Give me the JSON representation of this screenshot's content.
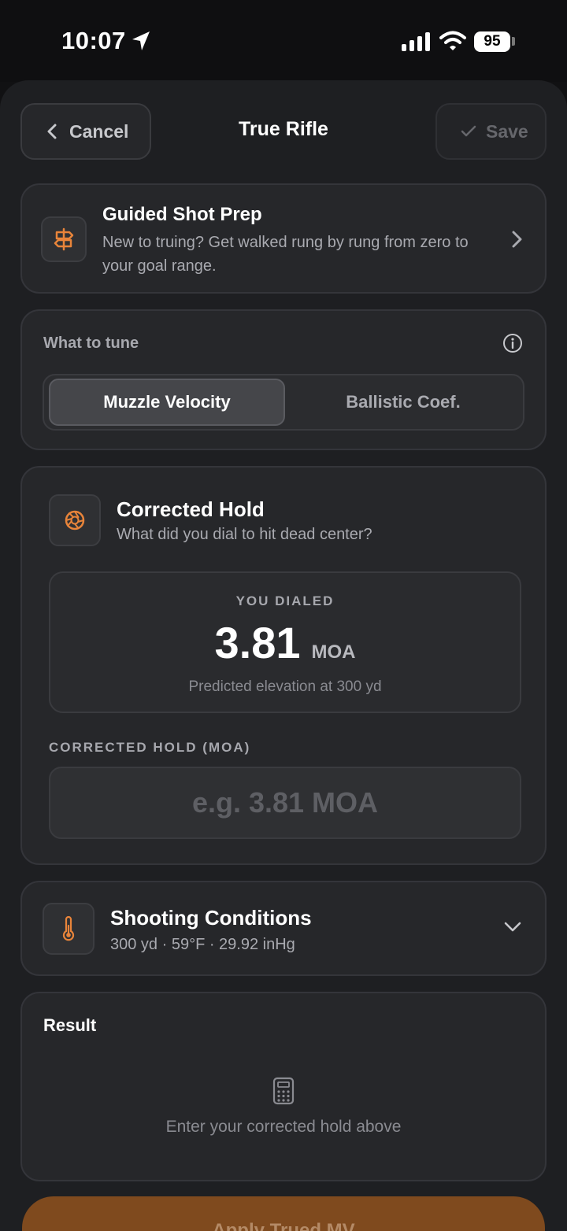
{
  "status_bar": {
    "time": "10:07",
    "battery": "95"
  },
  "header": {
    "cancel_label": "Cancel",
    "title": "True Rifle",
    "save_label": "Save"
  },
  "guided": {
    "title": "Guided Shot Prep",
    "description": "New to truing? Get walked rung by rung from zero to your goal range."
  },
  "tune": {
    "label": "What to tune",
    "options": [
      "Muzzle Velocity",
      "Ballistic Coef."
    ],
    "selected": "Muzzle Velocity"
  },
  "hold": {
    "title": "Corrected Hold",
    "subtitle": "What did you dial to hit dead center?",
    "dialed_label": "YOU DIALED",
    "dialed_value": "3.81",
    "dialed_unit": "MOA",
    "dialed_note": "Predicted elevation at 300 yd",
    "input_label": "CORRECTED HOLD (MOA)",
    "input_placeholder": "e.g. 3.81 MOA",
    "input_value": ""
  },
  "conditions": {
    "title": "Shooting Conditions",
    "summary": "300 yd · 59°F · 29.92 inHg"
  },
  "result": {
    "title": "Result",
    "empty_text": "Enter your corrected hold above"
  },
  "apply": {
    "label": "Apply Trued MV"
  },
  "colors": {
    "accent": "#e8843a",
    "background": "#1e1f22",
    "card": "#26272a"
  }
}
